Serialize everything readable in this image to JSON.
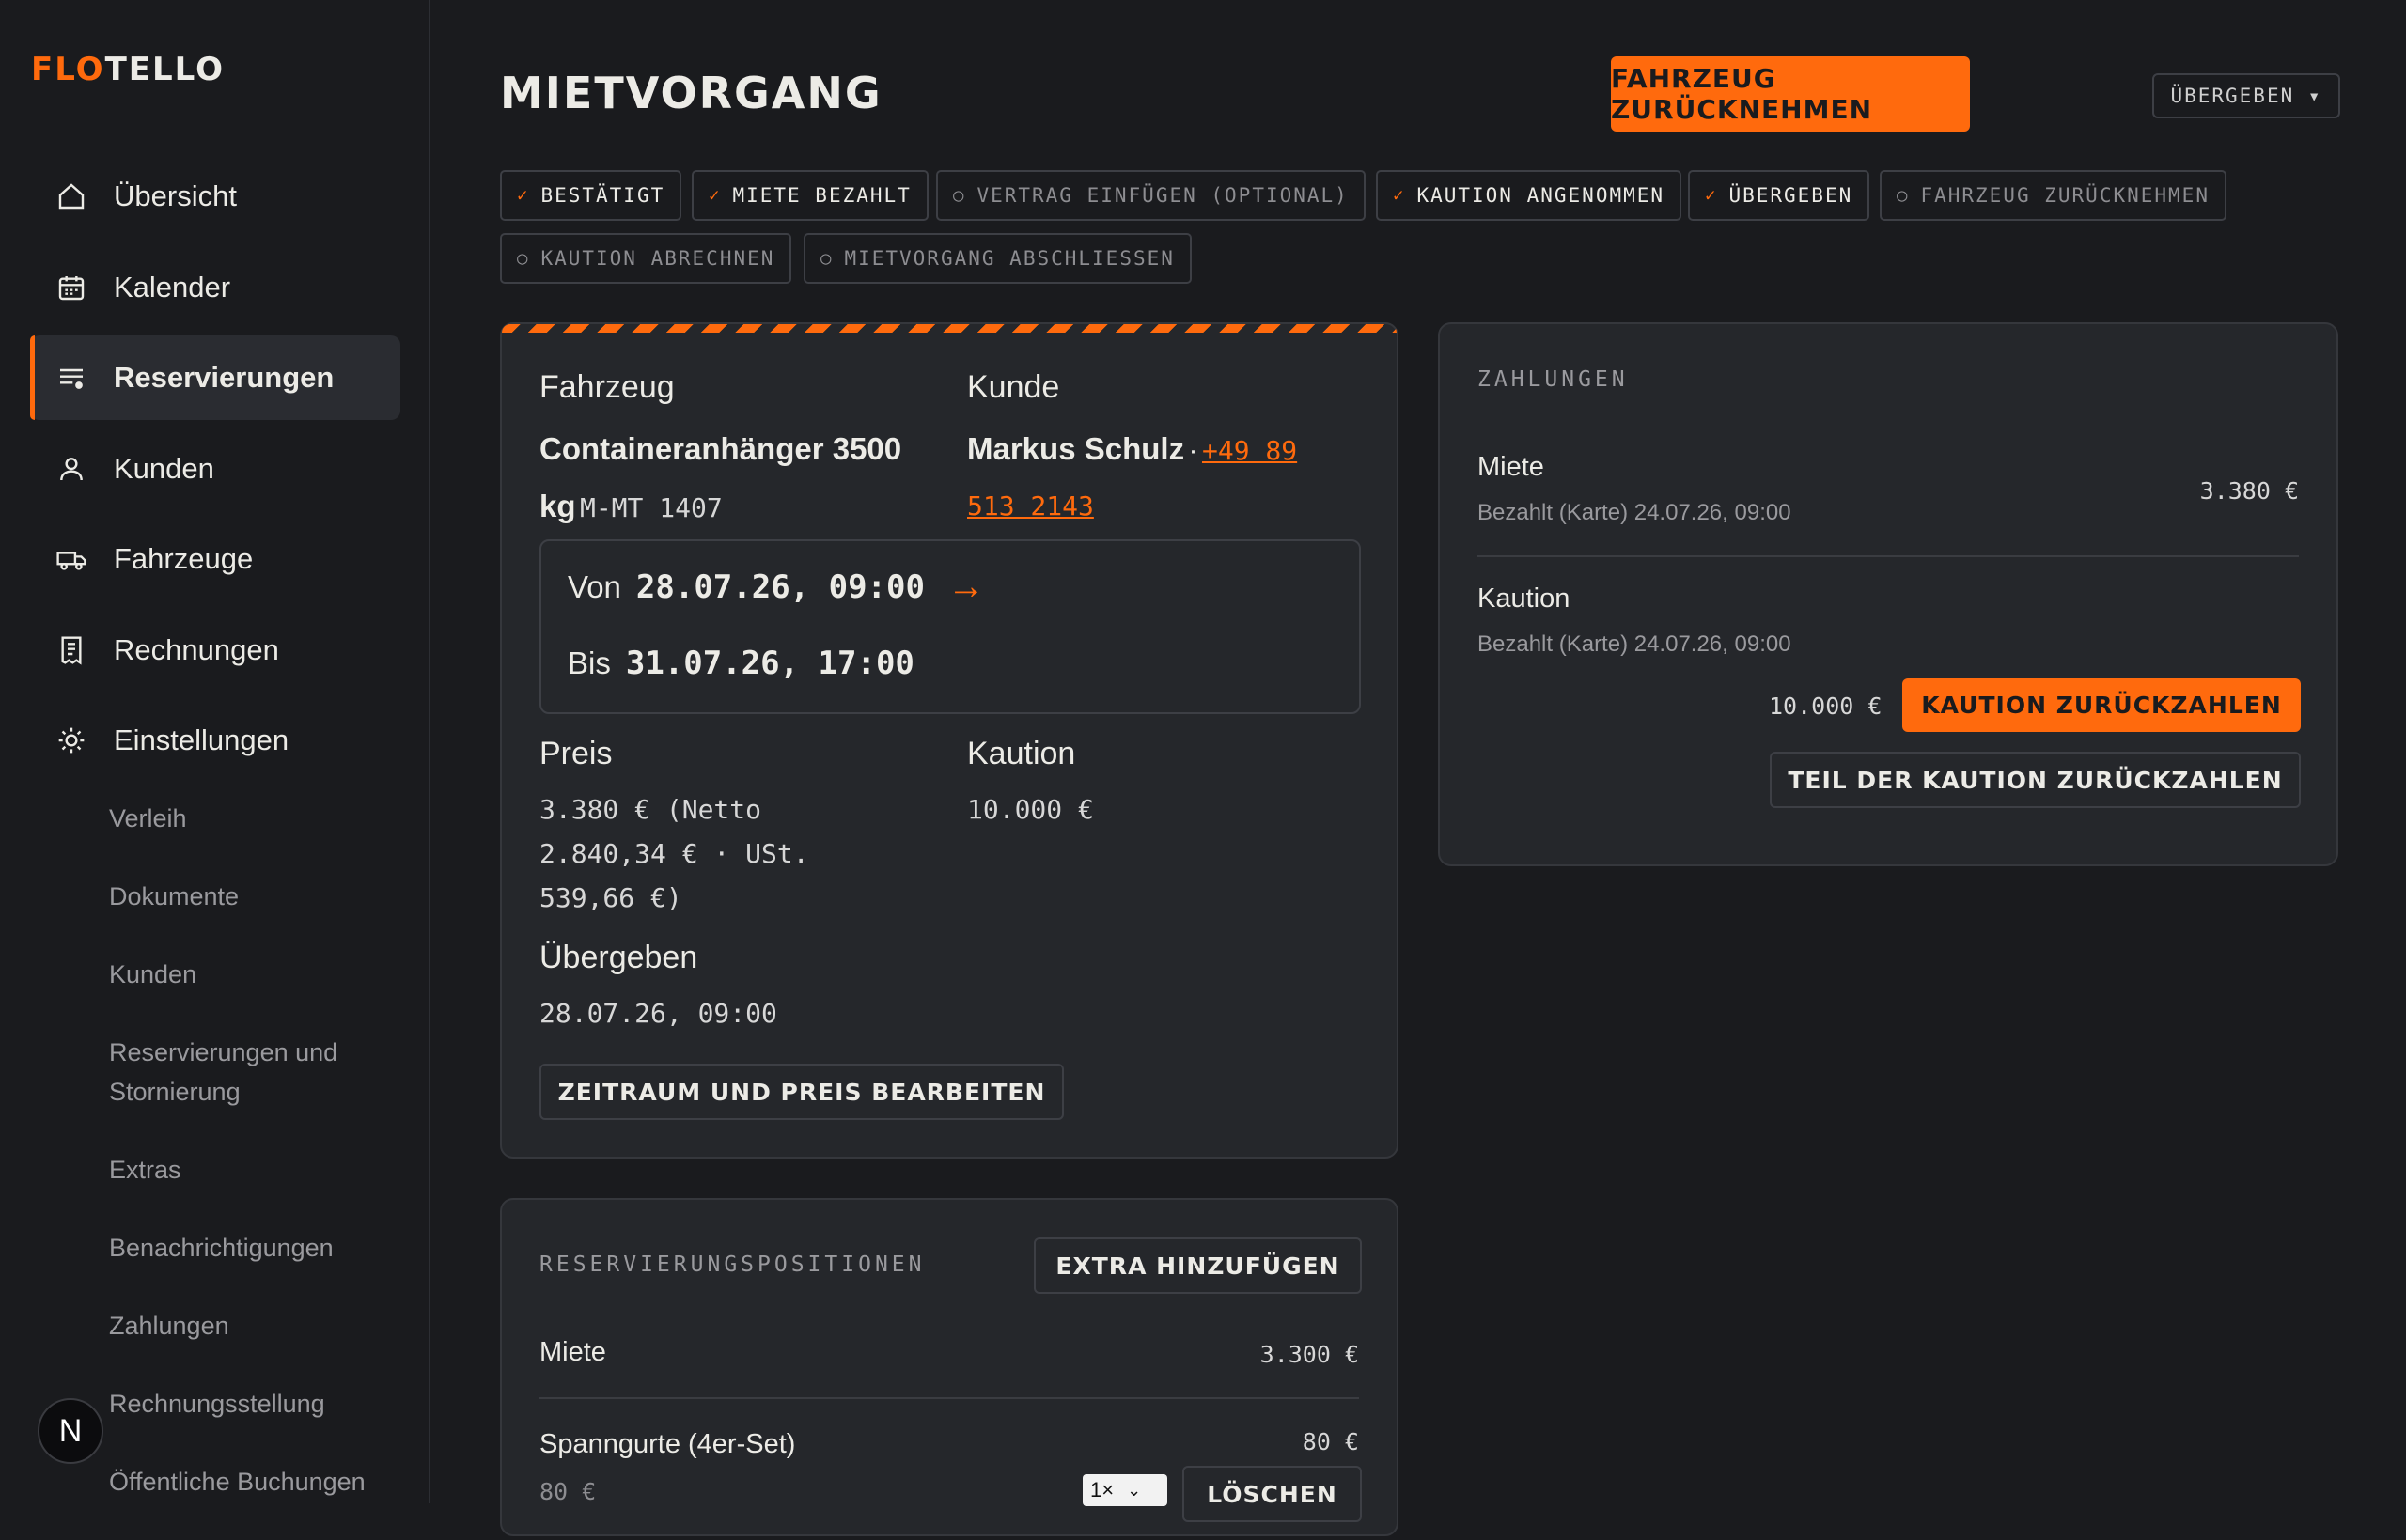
{
  "brand": {
    "logo_accent": "FLO",
    "logo_rest": "TELLO",
    "accent_color": "#ff6a0d"
  },
  "sidebar": {
    "items": [
      {
        "label": "Übersicht",
        "icon": "home-icon"
      },
      {
        "label": "Kalender",
        "icon": "calendar-icon"
      },
      {
        "label": "Reservierungen",
        "icon": "list-icon",
        "active": true
      },
      {
        "label": "Kunden",
        "icon": "user-icon"
      },
      {
        "label": "Fahrzeuge",
        "icon": "truck-icon"
      },
      {
        "label": "Rechnungen",
        "icon": "receipt-icon"
      },
      {
        "label": "Einstellungen",
        "icon": "gear-icon"
      }
    ],
    "subitems": [
      "Verleih",
      "Dokumente",
      "Kunden",
      "Reservierungen und Stornierung",
      "Extras",
      "Benachrichtigungen",
      "Zahlungen",
      "Rechnungsstellung",
      "Öffentliche Buchungen"
    ],
    "badge": "N"
  },
  "header": {
    "title": "MIETVORGANG",
    "primary_action": "FAHRZEUG ZURÜCKNEHMEN",
    "status_select": "ÜBERGEBEN ▾"
  },
  "steps": [
    {
      "label": "BESTÄTIGT",
      "done": true
    },
    {
      "label": "MIETE BEZAHLT",
      "done": true
    },
    {
      "label": "VERTRAG EINFÜGEN (OPTIONAL)",
      "done": false
    },
    {
      "label": "KAUTION ANGENOMMEN",
      "done": true
    },
    {
      "label": "ÜBERGEBEN",
      "done": true
    },
    {
      "label": "FAHRZEUG ZURÜCKNEHMEN",
      "done": false
    },
    {
      "label": "KAUTION ABRECHNEN",
      "done": false
    },
    {
      "label": "MIETVORGANG ABSCHLIESSEN",
      "done": false
    }
  ],
  "details": {
    "vehicle_label": "Fahrzeug",
    "vehicle_name_1": "Containeranhänger 3500",
    "vehicle_name_2": "kg",
    "vehicle_plate": "M-MT 1407",
    "customer_label": "Kunde",
    "customer_name": "Markus Schulz",
    "customer_sep": "·",
    "customer_phone_1": "+49 89",
    "customer_phone_2": "513 2143",
    "from_label": "Von",
    "from_value": "28.07.26, 09:00",
    "arrow": "→",
    "to_label": "Bis",
    "to_value": "31.07.26, 17:00",
    "price_label": "Preis",
    "price_line1": "3.380 € (Netto",
    "price_line2": "2.840,34 € · USt.",
    "price_line3": "539,66 €)",
    "deposit_label": "Kaution",
    "deposit_value": "10.000 €",
    "handover_label": "Übergeben",
    "handover_value": "28.07.26, 09:00",
    "edit_button": "ZEITRAUM UND PREIS BEARBEITEN"
  },
  "payments": {
    "title": "ZAHLUNGEN",
    "rent_label": "Miete",
    "rent_sub": "Bezahlt (Karte) 24.07.26, 09:00",
    "rent_amount": "3.380 €",
    "deposit_label": "Kaution",
    "deposit_sub": "Bezahlt (Karte) 24.07.26, 09:00",
    "deposit_amount": "10.000 €",
    "refund_button": "KAUTION ZURÜCKZAHLEN",
    "partial_refund_button": "TEIL DER KAUTION ZURÜCKZAHLEN"
  },
  "positions": {
    "title": "RESERVIERUNGSPOSITIONEN",
    "add_button": "EXTRA HINZUFÜGEN",
    "rows": [
      {
        "label": "Miete",
        "amount": "3.300 €"
      },
      {
        "label": "Spanngurte (4er-Set)",
        "amount": "80 €",
        "unit_price": "80 €",
        "qty": "1×",
        "delete": "LÖSCHEN"
      }
    ]
  }
}
